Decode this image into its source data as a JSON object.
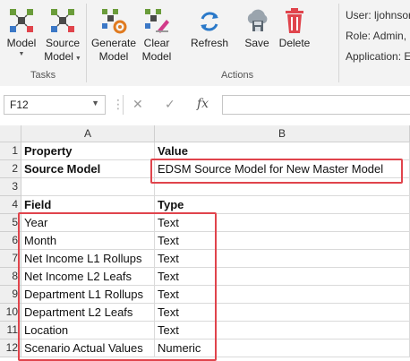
{
  "ribbon": {
    "groups": {
      "tasks": "Tasks",
      "actions": "Actions"
    },
    "buttons": {
      "model": {
        "line1": "Model",
        "icon": "model-hierarchy-icon"
      },
      "source_model": {
        "line1": "Source",
        "line2": "Model",
        "icon": "source-model-icon"
      },
      "generate_model": {
        "line1": "Generate",
        "line2": "Model",
        "icon": "generate-model-icon"
      },
      "clear_model": {
        "line1": "Clear",
        "line2": "Model",
        "icon": "clear-model-icon"
      },
      "refresh": {
        "line1": "Refresh",
        "icon": "refresh-icon"
      },
      "save": {
        "line1": "Save",
        "icon": "cloud-save-icon"
      },
      "delete": {
        "line1": "Delete",
        "icon": "trash-icon"
      }
    },
    "user_info": {
      "user": "User: ljohnsor",
      "role": "Role: Admin, (",
      "application": "Application: E"
    }
  },
  "formula_bar": {
    "name_box": "F12",
    "cancel_symbol": "✕",
    "enter_symbol": "✓",
    "fx_symbol": "fx",
    "formula": ""
  },
  "sheet": {
    "columns": [
      "A",
      "B"
    ],
    "rows": [
      {
        "num": "1",
        "a": "Property",
        "b": "Value",
        "bold": true
      },
      {
        "num": "2",
        "a": "Source Model",
        "b": "EDSM Source Model for New Master Model",
        "bold_a": true
      },
      {
        "num": "3",
        "a": "",
        "b": ""
      },
      {
        "num": "4",
        "a": "Field",
        "b": "Type",
        "bold": true
      },
      {
        "num": "5",
        "a": "Year",
        "b": "Text"
      },
      {
        "num": "6",
        "a": "Month",
        "b": "Text"
      },
      {
        "num": "7",
        "a": "Net Income L1 Rollups",
        "b": "Text"
      },
      {
        "num": "8",
        "a": "Net Income L2 Leafs",
        "b": "Text"
      },
      {
        "num": "9",
        "a": "Department L1 Rollups",
        "b": "Text"
      },
      {
        "num": "10",
        "a": "Department L2 Leafs",
        "b": "Text"
      },
      {
        "num": "11",
        "a": "Location",
        "b": "Text"
      },
      {
        "num": "12",
        "a": "Scenario Actual Values",
        "b": "Numeric"
      }
    ]
  },
  "colors": {
    "highlight": "#e0444c",
    "ribbon_bg": "#f3f3f3",
    "header_bg": "#efefef"
  }
}
